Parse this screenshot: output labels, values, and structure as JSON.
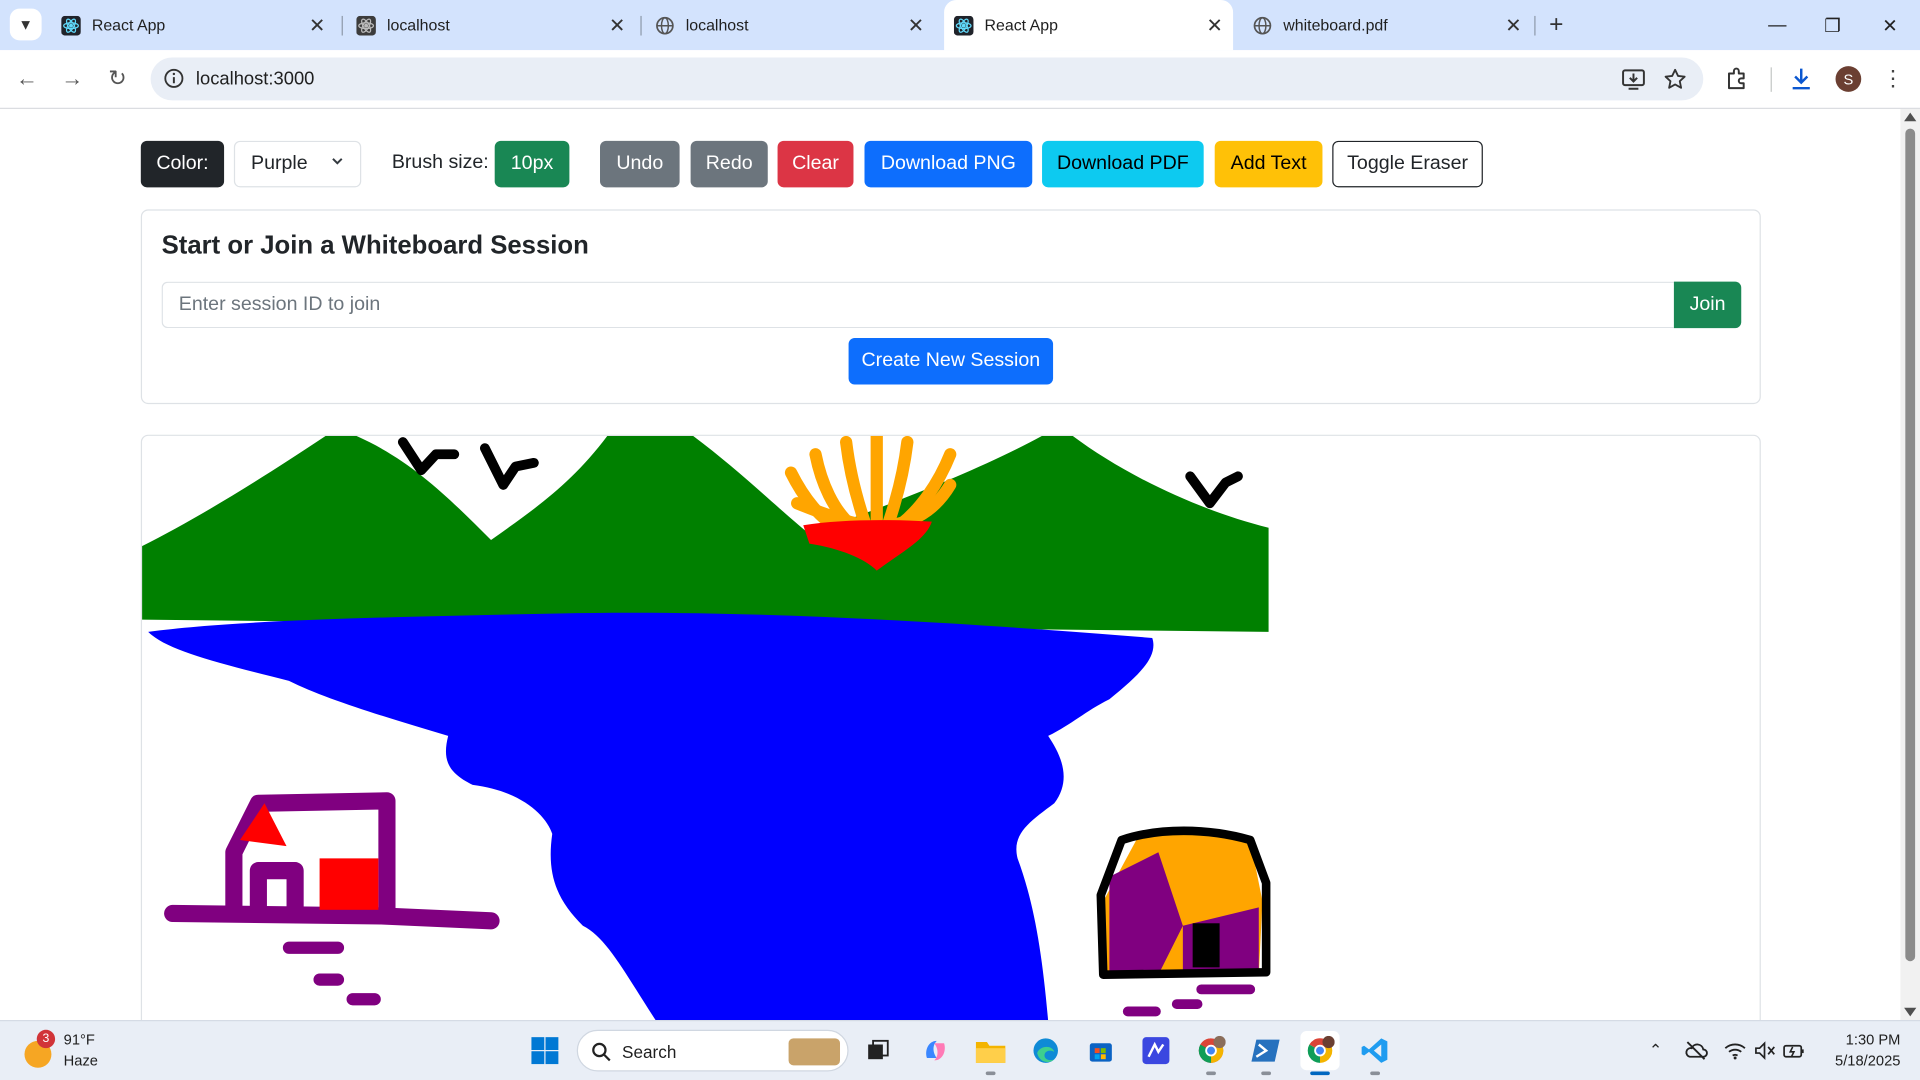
{
  "browser": {
    "tabs": [
      {
        "title": "React App",
        "icon": "react-icon"
      },
      {
        "title": "localhost",
        "icon": "react-icon"
      },
      {
        "title": "localhost",
        "icon": "globe-icon"
      },
      {
        "title": "React App",
        "icon": "react-icon",
        "active": true
      },
      {
        "title": "whiteboard.pdf",
        "icon": "globe-icon"
      }
    ],
    "url": "localhost:3000",
    "profile_initial": "S"
  },
  "toolbar": {
    "color_label": "Color:",
    "color_value": "Purple",
    "color_options": [
      "Purple"
    ],
    "brush_label": "Brush size:",
    "brush_value": "10px",
    "undo": "Undo",
    "redo": "Redo",
    "clear": "Clear",
    "download_png": "Download PNG",
    "download_pdf": "Download PDF",
    "add_text": "Add Text",
    "toggle_eraser": "Toggle Eraser"
  },
  "session": {
    "title": "Start or Join a Whiteboard Session",
    "input_placeholder": "Enter session ID to join",
    "input_value": "",
    "join": "Join",
    "create": "Create New Session"
  },
  "colors": {
    "mountains": "#008000",
    "water": "#0000ff",
    "sun_rays": "#ffa500",
    "sun": "#ff0000",
    "birds": "#000000",
    "house_outline": "#800080",
    "house_fill": "#ff0000",
    "house2_fill": "#ffa500"
  },
  "taskbar": {
    "weather_temp": "91°F",
    "weather_desc": "Haze",
    "weather_badge": "3",
    "search_label": "Search",
    "time": "1:30 PM",
    "date": "5/18/2025"
  }
}
